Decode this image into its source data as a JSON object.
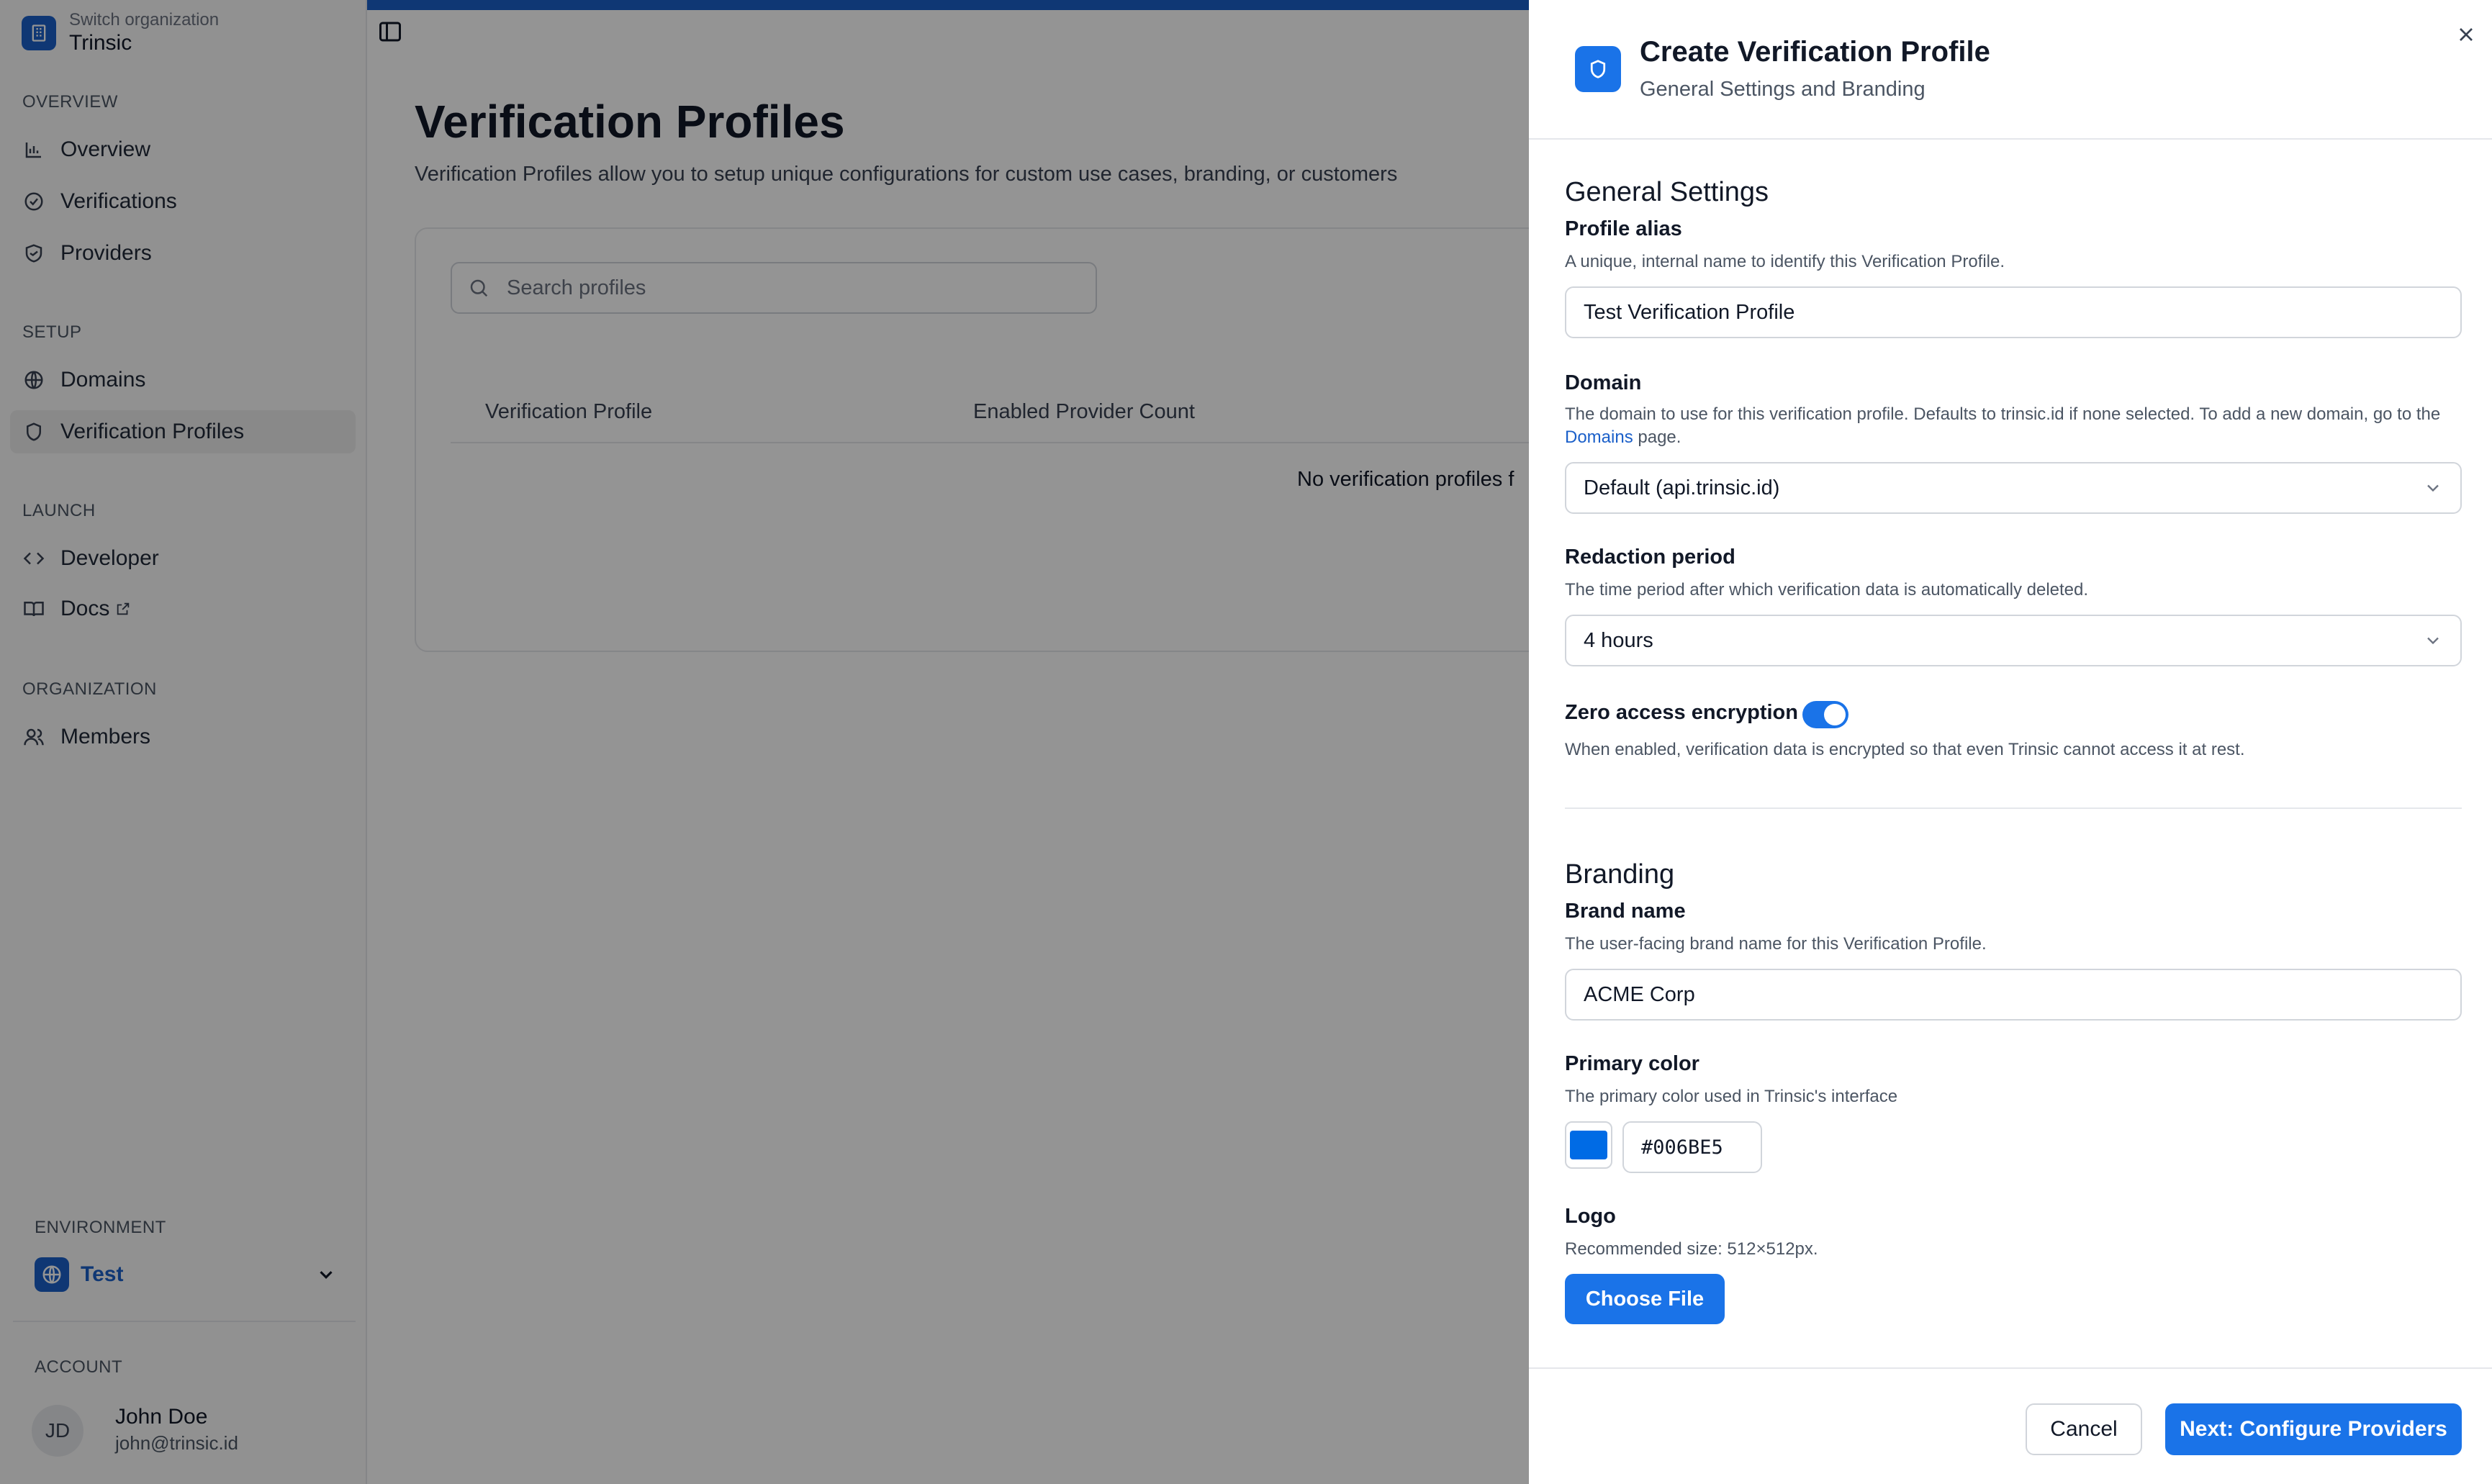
{
  "sidebar": {
    "org_switch_label": "Switch organization",
    "org_name": "Trinsic",
    "sections": {
      "overview": "OVERVIEW",
      "setup": "SETUP",
      "launch": "LAUNCH",
      "organization": "ORGANIZATION"
    },
    "items": {
      "overview": "Overview",
      "verifications": "Verifications",
      "providers": "Providers",
      "domains": "Domains",
      "verification_profiles": "Verification Profiles",
      "developer": "Developer",
      "docs": "Docs",
      "members": "Members"
    },
    "active_item": "Verification Profiles",
    "environment_label": "ENVIRONMENT",
    "environment_name": "Test",
    "account_label": "ACCOUNT",
    "user_initials": "JD",
    "user_name": "John Doe",
    "user_email": "john@trinsic.id"
  },
  "main": {
    "title": "Verification Profiles",
    "description": "Verification Profiles allow you to setup unique configurations for custom use cases, branding, or customers",
    "search_placeholder": "Search profiles",
    "columns": [
      "Verification Profile",
      "Enabled Provider Count"
    ],
    "empty_message": "No verification profiles f"
  },
  "panel": {
    "title": "Create Verification Profile",
    "subtitle": "General Settings and Branding",
    "general_title": "General Settings",
    "alias_label": "Profile alias",
    "alias_help": "A unique, internal name to identify this Verification Profile.",
    "alias_value": "Test Verification Profile",
    "domain_label": "Domain",
    "domain_help_pre": "The domain to use for this verification profile. Defaults to trinsic.id if none selected. To add a new domain, go to the ",
    "domain_help_link": "Domains",
    "domain_help_post": " page.",
    "domain_value": "Default (api.trinsic.id)",
    "redaction_label": "Redaction period",
    "redaction_help": "The time period after which verification data is automatically deleted.",
    "redaction_value": "4 hours",
    "encryption_label": "Zero access encryption",
    "encryption_enabled": true,
    "encryption_help": "When enabled, verification data is encrypted so that even Trinsic cannot access it at rest.",
    "branding_title": "Branding",
    "brand_label": "Brand name",
    "brand_help": "The user-facing brand name for this Verification Profile.",
    "brand_value": "ACME Corp",
    "color_label": "Primary color",
    "color_help": "The primary color used in Trinsic's interface",
    "color_value": "#006BE5",
    "logo_label": "Logo",
    "logo_help": "Recommended size: 512×512px.",
    "choose_file_label": "Choose File",
    "cancel_label": "Cancel",
    "next_label": "Next: Configure Providers"
  },
  "colors": {
    "accent": "#1a73e8",
    "brand_blue": "#1a5fc9",
    "primary_color_swatch": "#006BE5"
  },
  "icons": {
    "org": "building-icon",
    "overview": "bar-chart-icon",
    "verifications": "check-circle-icon",
    "providers": "shield-handshake-icon",
    "domains": "globe-icon",
    "verification_profiles": "shield-icon",
    "developer": "code-icon",
    "docs": "book-icon",
    "members": "users-icon",
    "search": "search-icon",
    "close": "close-icon",
    "chevron": "chevron-down-icon"
  }
}
